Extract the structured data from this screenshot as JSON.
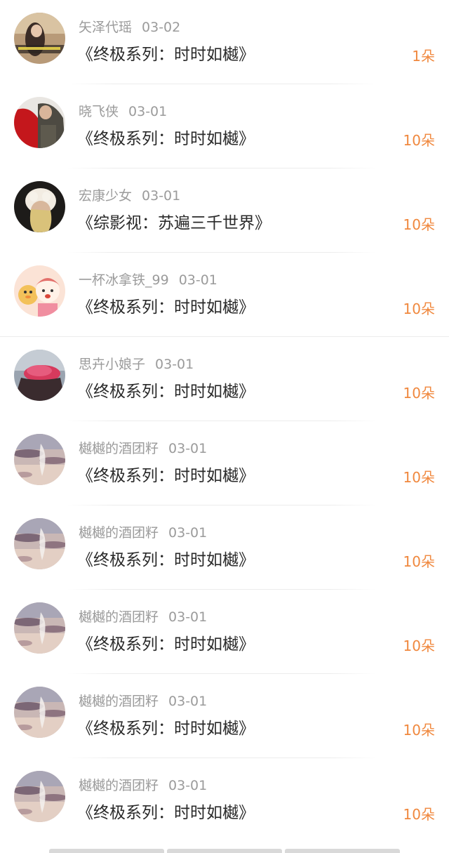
{
  "colors": {
    "flower_count": "#f0883e",
    "meta_text": "#9b9b9b",
    "title_text": "#2a2a2a"
  },
  "rows": [
    {
      "user": "矢泽代瑶",
      "date": "03-02",
      "title": "《终极系列：时时如樾》",
      "flowers": "1朵",
      "avatar": "photo-avatar-icon"
    },
    {
      "user": "晓飞侠",
      "date": "03-01",
      "title": "《终极系列：时时如樾》",
      "flowers": "10朵",
      "avatar": "photo-avatar-icon"
    },
    {
      "user": "宏康少女",
      "date": "03-01",
      "title": "《综影视：苏遍三千世界》",
      "flowers": "10朵",
      "avatar": "photo-avatar-icon"
    },
    {
      "user": "一杯冰拿铁_99",
      "date": "03-01",
      "title": "《终极系列：时时如樾》",
      "flowers": "10朵",
      "avatar": "cartoon-avatar-icon"
    },
    {
      "user": "思卉小娘子",
      "date": "03-01",
      "title": "《终极系列：时时如樾》",
      "flowers": "10朵",
      "avatar": "photo-avatar-icon"
    },
    {
      "user": "樾樾的酒团籽",
      "date": "03-01",
      "title": "《终极系列：时时如樾》",
      "flowers": "10朵",
      "avatar": "sky-avatar-icon"
    },
    {
      "user": "樾樾的酒团籽",
      "date": "03-01",
      "title": "《终极系列：时时如樾》",
      "flowers": "10朵",
      "avatar": "sky-avatar-icon"
    },
    {
      "user": "樾樾的酒团籽",
      "date": "03-01",
      "title": "《终极系列：时时如樾》",
      "flowers": "10朵",
      "avatar": "sky-avatar-icon"
    },
    {
      "user": "樾樾的酒团籽",
      "date": "03-01",
      "title": "《终极系列：时时如樾》",
      "flowers": "10朵",
      "avatar": "sky-avatar-icon"
    },
    {
      "user": "樾樾的酒团籽",
      "date": "03-01",
      "title": "《终极系列：时时如樾》",
      "flowers": "10朵",
      "avatar": "sky-avatar-icon"
    }
  ]
}
